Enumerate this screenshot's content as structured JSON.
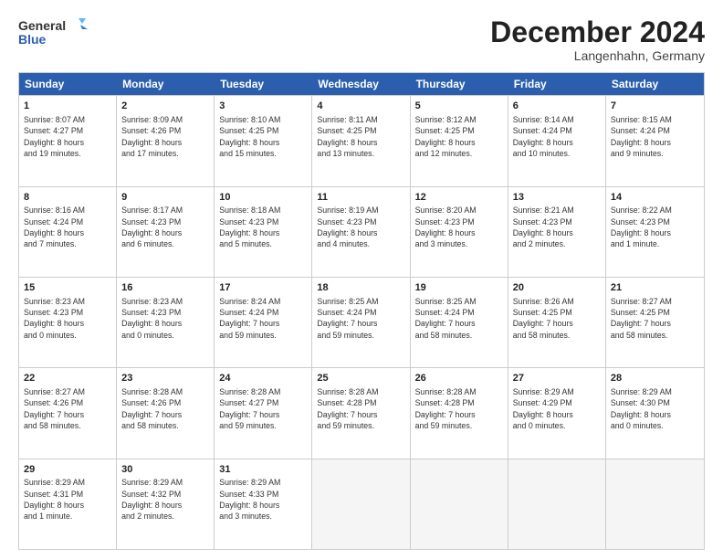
{
  "header": {
    "logo_line1": "General",
    "logo_line2": "Blue",
    "month_title": "December 2024",
    "location": "Langenhahn, Germany"
  },
  "days_of_week": [
    "Sunday",
    "Monday",
    "Tuesday",
    "Wednesday",
    "Thursday",
    "Friday",
    "Saturday"
  ],
  "rows": [
    [
      {
        "day": "1",
        "lines": [
          "Sunrise: 8:07 AM",
          "Sunset: 4:27 PM",
          "Daylight: 8 hours",
          "and 19 minutes."
        ]
      },
      {
        "day": "2",
        "lines": [
          "Sunrise: 8:09 AM",
          "Sunset: 4:26 PM",
          "Daylight: 8 hours",
          "and 17 minutes."
        ]
      },
      {
        "day": "3",
        "lines": [
          "Sunrise: 8:10 AM",
          "Sunset: 4:25 PM",
          "Daylight: 8 hours",
          "and 15 minutes."
        ]
      },
      {
        "day": "4",
        "lines": [
          "Sunrise: 8:11 AM",
          "Sunset: 4:25 PM",
          "Daylight: 8 hours",
          "and 13 minutes."
        ]
      },
      {
        "day": "5",
        "lines": [
          "Sunrise: 8:12 AM",
          "Sunset: 4:25 PM",
          "Daylight: 8 hours",
          "and 12 minutes."
        ]
      },
      {
        "day": "6",
        "lines": [
          "Sunrise: 8:14 AM",
          "Sunset: 4:24 PM",
          "Daylight: 8 hours",
          "and 10 minutes."
        ]
      },
      {
        "day": "7",
        "lines": [
          "Sunrise: 8:15 AM",
          "Sunset: 4:24 PM",
          "Daylight: 8 hours",
          "and 9 minutes."
        ]
      }
    ],
    [
      {
        "day": "8",
        "lines": [
          "Sunrise: 8:16 AM",
          "Sunset: 4:24 PM",
          "Daylight: 8 hours",
          "and 7 minutes."
        ]
      },
      {
        "day": "9",
        "lines": [
          "Sunrise: 8:17 AM",
          "Sunset: 4:23 PM",
          "Daylight: 8 hours",
          "and 6 minutes."
        ]
      },
      {
        "day": "10",
        "lines": [
          "Sunrise: 8:18 AM",
          "Sunset: 4:23 PM",
          "Daylight: 8 hours",
          "and 5 minutes."
        ]
      },
      {
        "day": "11",
        "lines": [
          "Sunrise: 8:19 AM",
          "Sunset: 4:23 PM",
          "Daylight: 8 hours",
          "and 4 minutes."
        ]
      },
      {
        "day": "12",
        "lines": [
          "Sunrise: 8:20 AM",
          "Sunset: 4:23 PM",
          "Daylight: 8 hours",
          "and 3 minutes."
        ]
      },
      {
        "day": "13",
        "lines": [
          "Sunrise: 8:21 AM",
          "Sunset: 4:23 PM",
          "Daylight: 8 hours",
          "and 2 minutes."
        ]
      },
      {
        "day": "14",
        "lines": [
          "Sunrise: 8:22 AM",
          "Sunset: 4:23 PM",
          "Daylight: 8 hours",
          "and 1 minute."
        ]
      }
    ],
    [
      {
        "day": "15",
        "lines": [
          "Sunrise: 8:23 AM",
          "Sunset: 4:23 PM",
          "Daylight: 8 hours",
          "and 0 minutes."
        ]
      },
      {
        "day": "16",
        "lines": [
          "Sunrise: 8:23 AM",
          "Sunset: 4:23 PM",
          "Daylight: 8 hours",
          "and 0 minutes."
        ]
      },
      {
        "day": "17",
        "lines": [
          "Sunrise: 8:24 AM",
          "Sunset: 4:24 PM",
          "Daylight: 7 hours",
          "and 59 minutes."
        ]
      },
      {
        "day": "18",
        "lines": [
          "Sunrise: 8:25 AM",
          "Sunset: 4:24 PM",
          "Daylight: 7 hours",
          "and 59 minutes."
        ]
      },
      {
        "day": "19",
        "lines": [
          "Sunrise: 8:25 AM",
          "Sunset: 4:24 PM",
          "Daylight: 7 hours",
          "and 58 minutes."
        ]
      },
      {
        "day": "20",
        "lines": [
          "Sunrise: 8:26 AM",
          "Sunset: 4:25 PM",
          "Daylight: 7 hours",
          "and 58 minutes."
        ]
      },
      {
        "day": "21",
        "lines": [
          "Sunrise: 8:27 AM",
          "Sunset: 4:25 PM",
          "Daylight: 7 hours",
          "and 58 minutes."
        ]
      }
    ],
    [
      {
        "day": "22",
        "lines": [
          "Sunrise: 8:27 AM",
          "Sunset: 4:26 PM",
          "Daylight: 7 hours",
          "and 58 minutes."
        ]
      },
      {
        "day": "23",
        "lines": [
          "Sunrise: 8:28 AM",
          "Sunset: 4:26 PM",
          "Daylight: 7 hours",
          "and 58 minutes."
        ]
      },
      {
        "day": "24",
        "lines": [
          "Sunrise: 8:28 AM",
          "Sunset: 4:27 PM",
          "Daylight: 7 hours",
          "and 59 minutes."
        ]
      },
      {
        "day": "25",
        "lines": [
          "Sunrise: 8:28 AM",
          "Sunset: 4:28 PM",
          "Daylight: 7 hours",
          "and 59 minutes."
        ]
      },
      {
        "day": "26",
        "lines": [
          "Sunrise: 8:28 AM",
          "Sunset: 4:28 PM",
          "Daylight: 7 hours",
          "and 59 minutes."
        ]
      },
      {
        "day": "27",
        "lines": [
          "Sunrise: 8:29 AM",
          "Sunset: 4:29 PM",
          "Daylight: 8 hours",
          "and 0 minutes."
        ]
      },
      {
        "day": "28",
        "lines": [
          "Sunrise: 8:29 AM",
          "Sunset: 4:30 PM",
          "Daylight: 8 hours",
          "and 0 minutes."
        ]
      }
    ],
    [
      {
        "day": "29",
        "lines": [
          "Sunrise: 8:29 AM",
          "Sunset: 4:31 PM",
          "Daylight: 8 hours",
          "and 1 minute."
        ]
      },
      {
        "day": "30",
        "lines": [
          "Sunrise: 8:29 AM",
          "Sunset: 4:32 PM",
          "Daylight: 8 hours",
          "and 2 minutes."
        ]
      },
      {
        "day": "31",
        "lines": [
          "Sunrise: 8:29 AM",
          "Sunset: 4:33 PM",
          "Daylight: 8 hours",
          "and 3 minutes."
        ]
      },
      {
        "day": "",
        "lines": []
      },
      {
        "day": "",
        "lines": []
      },
      {
        "day": "",
        "lines": []
      },
      {
        "day": "",
        "lines": []
      }
    ]
  ]
}
